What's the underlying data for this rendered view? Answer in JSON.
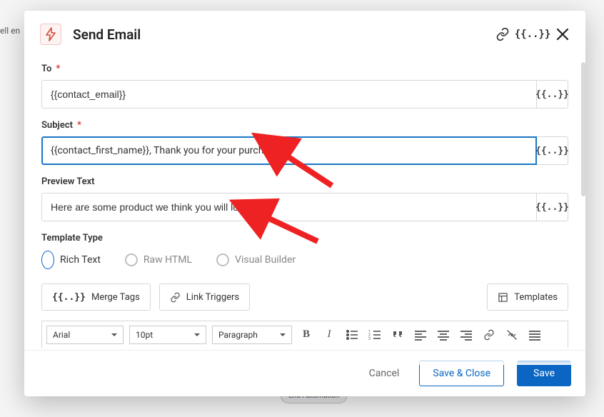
{
  "background": {
    "truncated_text": "ell en",
    "chip": "End Automation"
  },
  "header": {
    "title": "Send Email",
    "merge_glyph": "{{..}}"
  },
  "fields": {
    "to": {
      "label": "To",
      "value": "{{contact_email}}"
    },
    "subject": {
      "label": "Subject",
      "value": "{{contact_first_name}}, Thank you for your purchase!"
    },
    "preview": {
      "label": "Preview Text",
      "value": "Here are some product we think you will love!"
    }
  },
  "template_type": {
    "label": "Template Type",
    "options": [
      {
        "id": "rich",
        "label": "Rich Text",
        "selected": true
      },
      {
        "id": "raw",
        "label": "Raw HTML",
        "selected": false
      },
      {
        "id": "visual",
        "label": "Visual Builder",
        "selected": false
      }
    ]
  },
  "buttons": {
    "merge_tags": "Merge Tags",
    "link_triggers": "Link Triggers",
    "templates": "Templates"
  },
  "editor": {
    "font": "Arial",
    "size": "10pt",
    "block": "Paragraph"
  },
  "footer": {
    "cancel": "Cancel",
    "save_close": "Save & Close",
    "save": "Save"
  },
  "merge_glyph": "{{..}}"
}
